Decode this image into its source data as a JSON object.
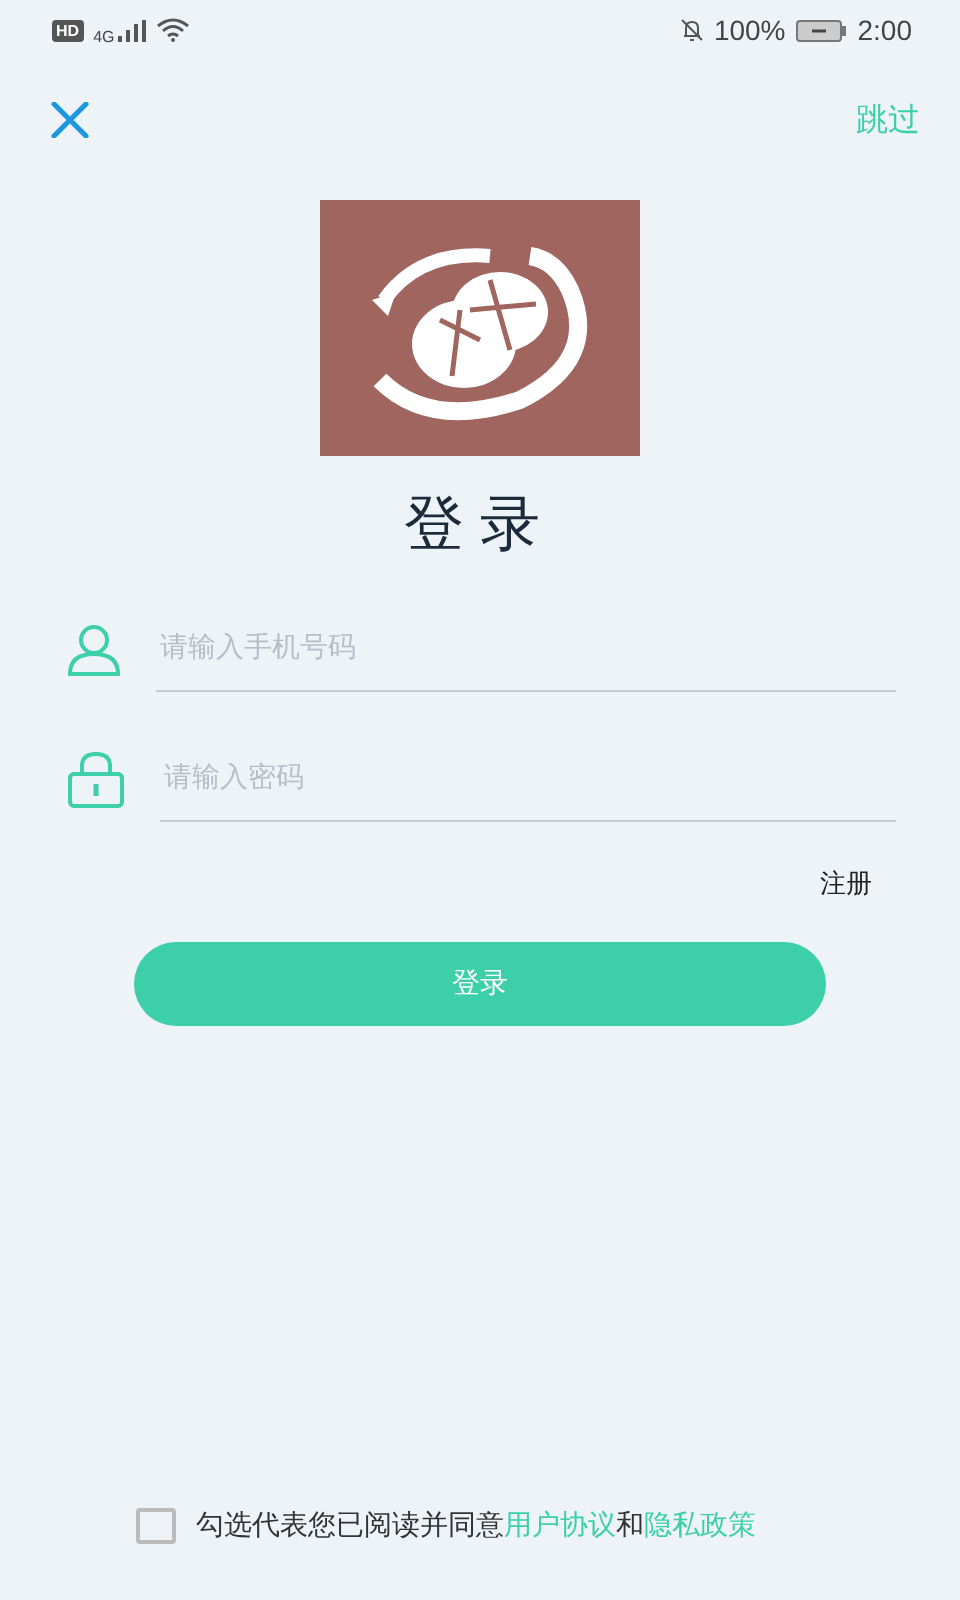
{
  "status_bar": {
    "hd": "HD",
    "network": "4G",
    "battery": "100%",
    "time": "2:00"
  },
  "header": {
    "skip": "跳过"
  },
  "title": "登录",
  "fields": [
    {
      "kind": "phone",
      "placeholder": "请输入手机号码"
    },
    {
      "kind": "password",
      "placeholder": "请输入密码"
    }
  ],
  "register_link": "注册",
  "login_button": "登录",
  "agreement": {
    "checked": false,
    "prefix": "勾选代表您已阅读并同意",
    "link_1": "用户协议",
    "joiner": "和",
    "link_2": "隐私政策"
  }
}
